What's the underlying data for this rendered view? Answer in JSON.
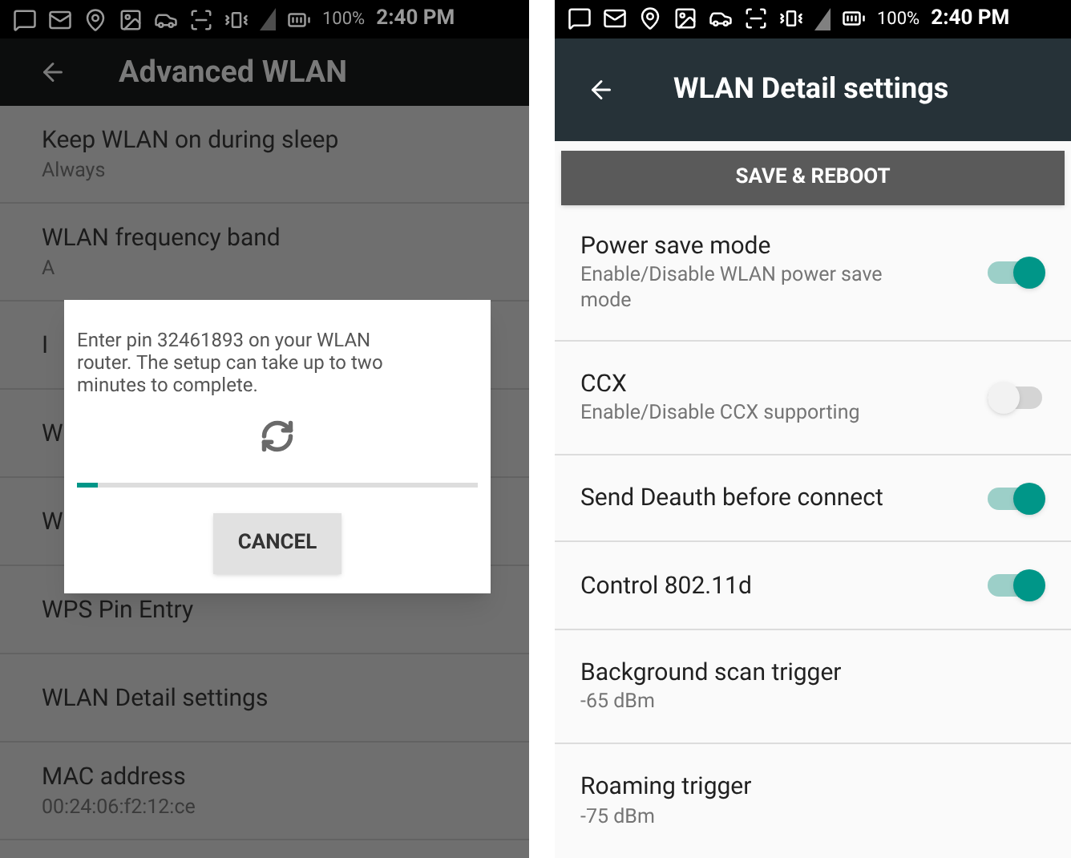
{
  "screens": [
    {
      "status_bar": {
        "battery": "100%",
        "time": "2:40 PM"
      },
      "title": "Advanced WLAN",
      "items": [
        {
          "title": "Keep WLAN on during sleep",
          "summary": "Always"
        },
        {
          "title": "WLAN frequency band",
          "summary": "A"
        },
        {
          "title": "I"
        },
        {
          "title": "W"
        },
        {
          "title": "W"
        },
        {
          "title": "WPS Pin Entry"
        },
        {
          "title": "WLAN Detail settings"
        },
        {
          "title": "MAC address",
          "summary": "00:24:06:f2:12:ce"
        }
      ],
      "dialog": {
        "message": "Enter pin 32461893 on your WLAN router. The setup can take up to two minutes to complete.",
        "progress": {
          "level": 0.05
        },
        "button": "CANCEL"
      }
    },
    {
      "status_bar": {
        "battery": "100%",
        "time": "2:40 PM"
      },
      "title": "WLAN Detail settings",
      "action_button": "SAVE & REBOOT",
      "items": [
        {
          "title": "Power save mode",
          "summary": "Enable/Disable WLAN power save mode",
          "kind": "switch",
          "on": true
        },
        {
          "title": "CCX",
          "summary": "Enable/Disable CCX supporting",
          "kind": "switch",
          "on": false
        },
        {
          "title": "Send Deauth before connect",
          "kind": "switch",
          "on": true
        },
        {
          "title": "Control 802.11d",
          "kind": "switch",
          "on": true
        },
        {
          "title": "Background scan trigger",
          "summary": "-65 dBm",
          "kind": "text"
        },
        {
          "title": "Roaming trigger",
          "summary": "-75 dBm",
          "kind": "text"
        }
      ]
    }
  ]
}
